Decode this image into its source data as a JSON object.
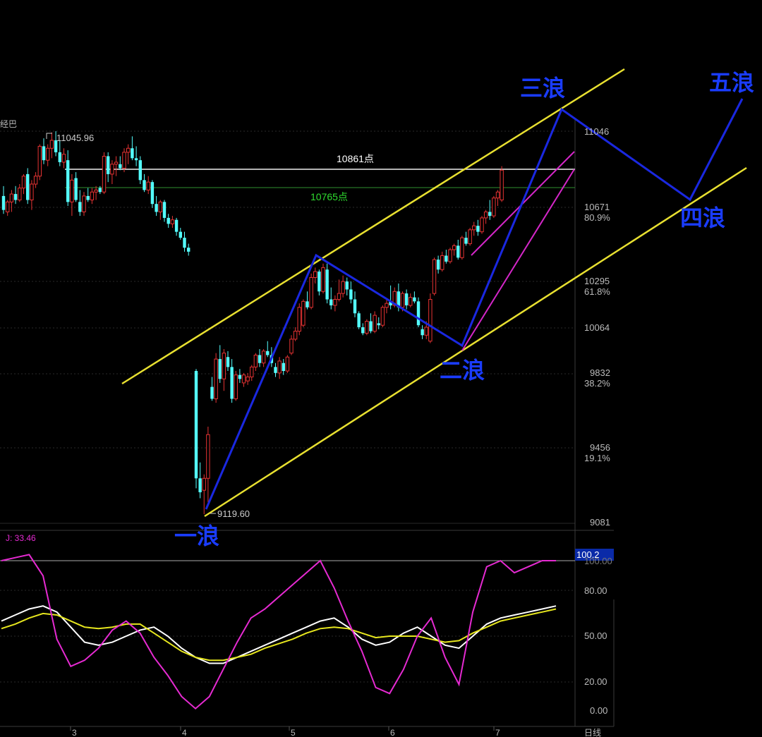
{
  "chart_data": {
    "type": "candlestick",
    "title_fragment": "经巴",
    "price_axis": {
      "ticks": [
        {
          "value": 11046,
          "label": "11046",
          "pct": ""
        },
        {
          "value": 10671,
          "label": "10671",
          "pct": "80.9%"
        },
        {
          "value": 10295,
          "label": "10295",
          "pct": "61.8%"
        },
        {
          "value": 10064,
          "label": "10064",
          "pct": ""
        },
        {
          "value": 9832,
          "label": "9832",
          "pct": "38.2%"
        },
        {
          "value": 9456,
          "label": "9456",
          "pct": "19.1%"
        },
        {
          "value": 9081,
          "label": "9081",
          "pct": ""
        }
      ]
    },
    "time_axis": {
      "months": [
        "3",
        "4",
        "5",
        "6",
        "7"
      ],
      "period_label": "日线"
    },
    "annotations": {
      "high_label": "11045.96",
      "low_label": "9119.60",
      "level_white": {
        "value": 10861,
        "label": "10861点"
      },
      "level_green": {
        "value": 10765,
        "label": "10765点"
      },
      "waves": [
        "一浪",
        "二浪",
        "三浪",
        "四浪",
        "五浪"
      ]
    },
    "indicator": {
      "name": "KDJ",
      "j_label": "J: 33.46",
      "current_value": "100.2",
      "ticks": [
        "100.00",
        "80.00",
        "50.00",
        "20.00",
        "0.00"
      ],
      "series": [
        {
          "key": "K",
          "color": "#ffffff",
          "values": [
            60,
            64,
            68,
            70,
            66,
            56,
            46,
            44,
            46,
            50,
            54,
            56,
            50,
            42,
            36,
            32,
            32,
            36,
            40,
            44,
            48,
            52,
            56,
            60,
            62,
            56,
            48,
            44,
            46,
            52,
            56,
            50,
            44,
            42,
            50,
            58,
            62,
            64,
            66,
            68,
            70
          ]
        },
        {
          "key": "D",
          "color": "#e6e61e",
          "values": [
            55,
            58,
            62,
            65,
            64,
            60,
            56,
            55,
            56,
            58,
            58,
            52,
            46,
            40,
            36,
            34,
            34,
            36,
            38,
            42,
            45,
            48,
            52,
            55,
            56,
            55,
            52,
            49,
            50,
            50,
            50,
            48,
            46,
            47,
            52,
            56,
            60,
            62,
            64,
            66,
            68
          ]
        },
        {
          "key": "J",
          "color": "#e62ad2",
          "values": [
            100,
            102,
            104,
            90,
            48,
            30,
            34,
            42,
            54,
            60,
            52,
            36,
            24,
            10,
            2,
            10,
            28,
            46,
            62,
            68,
            76,
            84,
            92,
            100,
            82,
            60,
            40,
            16,
            12,
            28,
            50,
            62,
            36,
            18,
            66,
            96,
            100,
            92,
            96,
            100,
            100
          ]
        }
      ]
    },
    "colors": {
      "up": "#e63333",
      "down": "#54ffff",
      "background": "#000000"
    },
    "candles": [
      {
        "o": 10720,
        "h": 10770,
        "l": 10630,
        "c": 10650
      },
      {
        "o": 10640,
        "h": 10700,
        "l": 10620,
        "c": 10690
      },
      {
        "o": 10690,
        "h": 10750,
        "l": 10640,
        "c": 10730
      },
      {
        "o": 10730,
        "h": 10770,
        "l": 10680,
        "c": 10700
      },
      {
        "o": 10700,
        "h": 10780,
        "l": 10690,
        "c": 10760
      },
      {
        "o": 10760,
        "h": 10830,
        "l": 10730,
        "c": 10820
      },
      {
        "o": 10830,
        "h": 10860,
        "l": 10680,
        "c": 10700
      },
      {
        "o": 10700,
        "h": 10800,
        "l": 10650,
        "c": 10780
      },
      {
        "o": 10780,
        "h": 10840,
        "l": 10760,
        "c": 10820
      },
      {
        "o": 10820,
        "h": 10980,
        "l": 10800,
        "c": 10970
      },
      {
        "o": 10970,
        "h": 11010,
        "l": 10880,
        "c": 10900
      },
      {
        "o": 10900,
        "h": 10980,
        "l": 10870,
        "c": 10960
      },
      {
        "o": 10960,
        "h": 11040,
        "l": 10910,
        "c": 11000
      },
      {
        "o": 11000,
        "h": 11046,
        "l": 10920,
        "c": 10940
      },
      {
        "o": 10940,
        "h": 11000,
        "l": 10870,
        "c": 10890
      },
      {
        "o": 10890,
        "h": 10960,
        "l": 10860,
        "c": 10930
      },
      {
        "o": 10900,
        "h": 10950,
        "l": 10670,
        "c": 10690
      },
      {
        "o": 10690,
        "h": 10830,
        "l": 10620,
        "c": 10800
      },
      {
        "o": 10810,
        "h": 10840,
        "l": 10690,
        "c": 10700
      },
      {
        "o": 10690,
        "h": 10750,
        "l": 10620,
        "c": 10640
      },
      {
        "o": 10640,
        "h": 10740,
        "l": 10620,
        "c": 10720
      },
      {
        "o": 10720,
        "h": 10760,
        "l": 10690,
        "c": 10700
      },
      {
        "o": 10700,
        "h": 10760,
        "l": 10680,
        "c": 10740
      },
      {
        "o": 10740,
        "h": 10770,
        "l": 10700,
        "c": 10750
      },
      {
        "o": 10760,
        "h": 10770,
        "l": 10730,
        "c": 10740
      },
      {
        "o": 10740,
        "h": 10940,
        "l": 10730,
        "c": 10920
      },
      {
        "o": 10920,
        "h": 10940,
        "l": 10790,
        "c": 10830
      },
      {
        "o": 10830,
        "h": 10900,
        "l": 10780,
        "c": 10880
      },
      {
        "o": 10880,
        "h": 10920,
        "l": 10820,
        "c": 10890
      },
      {
        "o": 10880,
        "h": 10920,
        "l": 10850,
        "c": 10860
      },
      {
        "o": 10860,
        "h": 10960,
        "l": 10840,
        "c": 10940
      },
      {
        "o": 10940,
        "h": 10980,
        "l": 10880,
        "c": 10960
      },
      {
        "o": 10960,
        "h": 11020,
        "l": 10900,
        "c": 10910
      },
      {
        "o": 10910,
        "h": 10970,
        "l": 10870,
        "c": 10900
      },
      {
        "o": 10900,
        "h": 10920,
        "l": 10780,
        "c": 10800
      },
      {
        "o": 10800,
        "h": 10830,
        "l": 10740,
        "c": 10750
      },
      {
        "o": 10750,
        "h": 10820,
        "l": 10730,
        "c": 10790
      },
      {
        "o": 10790,
        "h": 10800,
        "l": 10660,
        "c": 10680
      },
      {
        "o": 10680,
        "h": 10720,
        "l": 10620,
        "c": 10640
      },
      {
        "o": 10640,
        "h": 10700,
        "l": 10600,
        "c": 10690
      },
      {
        "o": 10690,
        "h": 10700,
        "l": 10590,
        "c": 10610
      },
      {
        "o": 10610,
        "h": 10630,
        "l": 10560,
        "c": 10580
      },
      {
        "o": 10580,
        "h": 10620,
        "l": 10560,
        "c": 10600
      },
      {
        "o": 10600,
        "h": 10610,
        "l": 10520,
        "c": 10540
      },
      {
        "o": 10540,
        "h": 10560,
        "l": 10500,
        "c": 10510
      },
      {
        "o": 10510,
        "h": 10540,
        "l": 10440,
        "c": 10460
      },
      {
        "o": 10460,
        "h": 10480,
        "l": 10420,
        "c": 10440
      },
      {
        "o": 9840,
        "h": 9850,
        "l": 9250,
        "c": 9300
      },
      {
        "o": 9300,
        "h": 9380,
        "l": 9200,
        "c": 9230
      },
      {
        "o": 9240,
        "h": 9320,
        "l": 9119.6,
        "c": 9300
      },
      {
        "o": 9300,
        "h": 9560,
        "l": 9180,
        "c": 9520
      },
      {
        "o": 9760,
        "h": 9810,
        "l": 9690,
        "c": 9700
      },
      {
        "o": 9700,
        "h": 9930,
        "l": 9680,
        "c": 9900
      },
      {
        "o": 9900,
        "h": 9970,
        "l": 9780,
        "c": 9800
      },
      {
        "o": 9800,
        "h": 9950,
        "l": 9740,
        "c": 9930
      },
      {
        "o": 9910,
        "h": 9940,
        "l": 9840,
        "c": 9860
      },
      {
        "o": 9860,
        "h": 9900,
        "l": 9680,
        "c": 9700
      },
      {
        "o": 9700,
        "h": 9840,
        "l": 9690,
        "c": 9820
      },
      {
        "o": 9820,
        "h": 9850,
        "l": 9780,
        "c": 9800
      },
      {
        "o": 9780,
        "h": 9830,
        "l": 9760,
        "c": 9820
      },
      {
        "o": 9790,
        "h": 9830,
        "l": 9770,
        "c": 9810
      },
      {
        "o": 9810,
        "h": 9870,
        "l": 9790,
        "c": 9860
      },
      {
        "o": 9860,
        "h": 9930,
        "l": 9840,
        "c": 9920
      },
      {
        "o": 9920,
        "h": 9950,
        "l": 9860,
        "c": 9880
      },
      {
        "o": 9880,
        "h": 9950,
        "l": 9860,
        "c": 9940
      },
      {
        "o": 9940,
        "h": 9990,
        "l": 9910,
        "c": 9920
      },
      {
        "o": 9920,
        "h": 9960,
        "l": 9860,
        "c": 9880
      },
      {
        "o": 9860,
        "h": 9880,
        "l": 9810,
        "c": 9830
      },
      {
        "o": 9830,
        "h": 9910,
        "l": 9800,
        "c": 9890
      },
      {
        "o": 9880,
        "h": 9900,
        "l": 9820,
        "c": 9840
      },
      {
        "o": 9840,
        "h": 9920,
        "l": 9830,
        "c": 9910
      },
      {
        "o": 9930,
        "h": 10020,
        "l": 9920,
        "c": 10000
      },
      {
        "o": 10000,
        "h": 10060,
        "l": 9990,
        "c": 10040
      },
      {
        "o": 10040,
        "h": 10180,
        "l": 10020,
        "c": 10160
      },
      {
        "o": 10070,
        "h": 10200,
        "l": 10060,
        "c": 10190
      },
      {
        "o": 10190,
        "h": 10240,
        "l": 10150,
        "c": 10160
      },
      {
        "o": 10160,
        "h": 10330,
        "l": 10150,
        "c": 10310
      },
      {
        "o": 10310,
        "h": 10360,
        "l": 10280,
        "c": 10340
      },
      {
        "o": 10340,
        "h": 10350,
        "l": 10220,
        "c": 10240
      },
      {
        "o": 10240,
        "h": 10380,
        "l": 10230,
        "c": 10360
      },
      {
        "o": 10350,
        "h": 10380,
        "l": 10180,
        "c": 10200
      },
      {
        "o": 10200,
        "h": 10260,
        "l": 10150,
        "c": 10170
      },
      {
        "o": 10170,
        "h": 10220,
        "l": 10140,
        "c": 10200
      },
      {
        "o": 10200,
        "h": 10300,
        "l": 10190,
        "c": 10230
      },
      {
        "o": 10230,
        "h": 10320,
        "l": 10210,
        "c": 10290
      },
      {
        "o": 10290,
        "h": 10310,
        "l": 10220,
        "c": 10250
      },
      {
        "o": 10250,
        "h": 10290,
        "l": 10180,
        "c": 10200
      },
      {
        "o": 10200,
        "h": 10240,
        "l": 10110,
        "c": 10130
      },
      {
        "o": 10130,
        "h": 10140,
        "l": 10050,
        "c": 10060
      },
      {
        "o": 10060,
        "h": 10080,
        "l": 10020,
        "c": 10030
      },
      {
        "o": 10030,
        "h": 10100,
        "l": 10020,
        "c": 10090
      },
      {
        "o": 10090,
        "h": 10130,
        "l": 10030,
        "c": 10040
      },
      {
        "o": 10040,
        "h": 10140,
        "l": 10030,
        "c": 10120
      },
      {
        "o": 10080,
        "h": 10110,
        "l": 10050,
        "c": 10070
      },
      {
        "o": 10070,
        "h": 10170,
        "l": 10060,
        "c": 10160
      },
      {
        "o": 10160,
        "h": 10200,
        "l": 10130,
        "c": 10180
      },
      {
        "o": 10190,
        "h": 10270,
        "l": 10150,
        "c": 10170
      },
      {
        "o": 10170,
        "h": 10260,
        "l": 10160,
        "c": 10240
      },
      {
        "o": 10240,
        "h": 10280,
        "l": 10140,
        "c": 10160
      },
      {
        "o": 10160,
        "h": 10240,
        "l": 10140,
        "c": 10230
      },
      {
        "o": 10230,
        "h": 10250,
        "l": 10150,
        "c": 10170
      },
      {
        "o": 10170,
        "h": 10230,
        "l": 10160,
        "c": 10210
      },
      {
        "o": 10210,
        "h": 10240,
        "l": 10180,
        "c": 10190
      },
      {
        "o": 10190,
        "h": 10210,
        "l": 10060,
        "c": 10070
      },
      {
        "o": 10050,
        "h": 10070,
        "l": 10000,
        "c": 10020
      },
      {
        "o": 10020,
        "h": 10090,
        "l": 10000,
        "c": 10060
      },
      {
        "o": 9990,
        "h": 10230,
        "l": 9980,
        "c": 10200
      },
      {
        "o": 10230,
        "h": 10410,
        "l": 10220,
        "c": 10400
      },
      {
        "o": 10400,
        "h": 10420,
        "l": 10330,
        "c": 10350
      },
      {
        "o": 10350,
        "h": 10440,
        "l": 10340,
        "c": 10420
      },
      {
        "o": 10420,
        "h": 10450,
        "l": 10380,
        "c": 10390
      },
      {
        "o": 10390,
        "h": 10460,
        "l": 10380,
        "c": 10450
      },
      {
        "o": 10450,
        "h": 10480,
        "l": 10420,
        "c": 10470
      },
      {
        "o": 10470,
        "h": 10500,
        "l": 10400,
        "c": 10410
      },
      {
        "o": 10410,
        "h": 10520,
        "l": 10400,
        "c": 10510
      },
      {
        "o": 10510,
        "h": 10540,
        "l": 10470,
        "c": 10480
      },
      {
        "o": 10480,
        "h": 10560,
        "l": 10470,
        "c": 10550
      },
      {
        "o": 10550,
        "h": 10590,
        "l": 10520,
        "c": 10570
      },
      {
        "o": 10570,
        "h": 10600,
        "l": 10520,
        "c": 10540
      },
      {
        "o": 10540,
        "h": 10620,
        "l": 10530,
        "c": 10610
      },
      {
        "o": 10610,
        "h": 10650,
        "l": 10580,
        "c": 10640
      },
      {
        "o": 10640,
        "h": 10700,
        "l": 10600,
        "c": 10620
      },
      {
        "o": 10620,
        "h": 10720,
        "l": 10610,
        "c": 10710
      },
      {
        "o": 10710,
        "h": 10750,
        "l": 10670,
        "c": 10740
      },
      {
        "o": 10700,
        "h": 10870,
        "l": 10690,
        "c": 10850
      }
    ]
  }
}
